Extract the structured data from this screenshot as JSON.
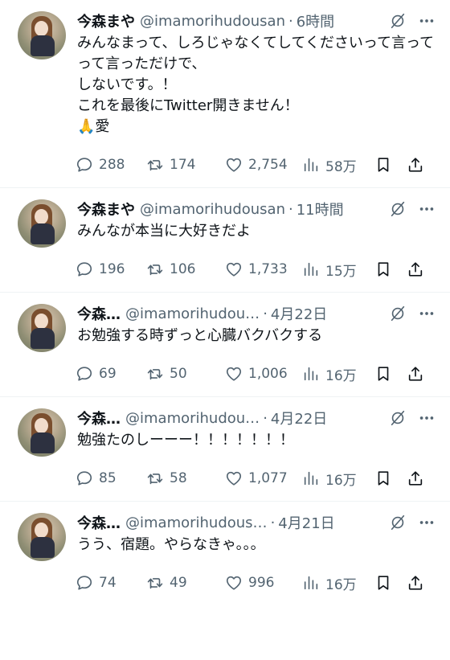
{
  "tweets": [
    {
      "name": "今森まや",
      "handle": "@imamorihudousan",
      "sep": "·",
      "time": "6時間",
      "text": "みんなまって、しろじゃなくてしてくださいって言ってって言っただけで、\nしないです。！\nこれを最後にTwitter開きません！\n🙏愛",
      "replies": "288",
      "retweets": "174",
      "likes": "2,754",
      "views": "58万"
    },
    {
      "name": "今森まや",
      "handle": "@imamorihudousan",
      "sep": "·",
      "time": "11時間",
      "text": "みんなが本当に大好きだよ",
      "replies": "196",
      "retweets": "106",
      "likes": "1,733",
      "views": "15万"
    },
    {
      "name": "今森…",
      "handle": "@imamorihudou…",
      "sep": "·",
      "time": "4月22日",
      "text": "お勉強する時ずっと心臓バクバクする",
      "replies": "69",
      "retweets": "50",
      "likes": "1,006",
      "views": "16万"
    },
    {
      "name": "今森…",
      "handle": "@imamorihudou…",
      "sep": "·",
      "time": "4月22日",
      "text": "勉強たのしーーー！！！！！！！",
      "replies": "85",
      "retweets": "58",
      "likes": "1,077",
      "views": "16万"
    },
    {
      "name": "今森…",
      "handle": "@imamorihudous…",
      "sep": "·",
      "time": "4月21日",
      "text": "うう、宿題。やらなきゃ。。。",
      "replies": "74",
      "retweets": "49",
      "likes": "996",
      "views": "16万"
    }
  ]
}
